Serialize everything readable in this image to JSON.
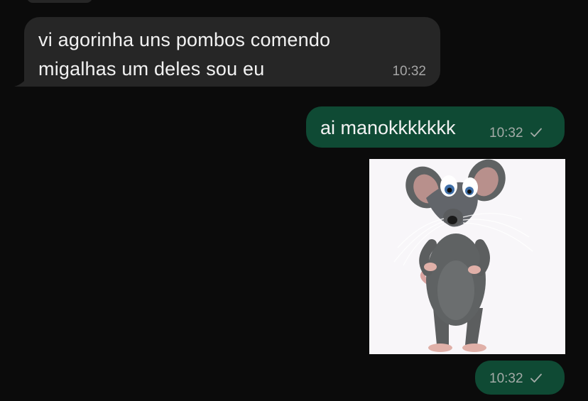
{
  "messages": [
    {
      "direction": "incoming",
      "lines": [
        "vi agorinha uns pombos comendo",
        "migalhas um deles sou eu"
      ],
      "time": "10:32"
    },
    {
      "direction": "outgoing",
      "text": "ai manokkkkkkk",
      "time": "10:32",
      "status": "sent-check-icon"
    },
    {
      "direction": "outgoing",
      "type": "sticker",
      "sticker": "crying-mouse-sticker",
      "time": "10:32",
      "status": "sent-check-icon"
    }
  ],
  "colors": {
    "background": "#0b0b0b",
    "incoming_bubble": "#262626",
    "outgoing_bubble": "#0f4a34",
    "timestamp": "#a3aba7"
  }
}
